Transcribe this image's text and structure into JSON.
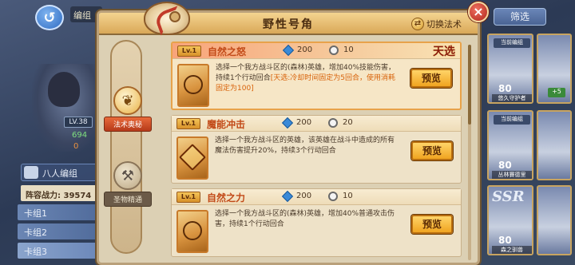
{
  "background": {
    "topbar_text": "编组",
    "hero_level": "LV.38",
    "hero_stat_1": "694",
    "hero_stat_2": "0",
    "crew_label": "八人编组",
    "power_label": "阵容战力: 39574",
    "decks": [
      "卡组1",
      "卡组2",
      "卡组3"
    ],
    "filter_label": "筛选",
    "cards": [
      {
        "grade": "当前编组",
        "level": "80",
        "name": "悠久守护者"
      },
      {
        "grade": "当前编组",
        "level": "80",
        "name": "丛林賽德里"
      },
      {
        "rarity": "SSR",
        "level": "80",
        "name": "森之驯兽"
      }
    ],
    "plus_label": "+5"
  },
  "dialog": {
    "title": "野性号角",
    "switch_label": "切换法术",
    "close_label": "×"
  },
  "side_tabs": [
    {
      "label": "法术奥秘",
      "active": true
    },
    {
      "label": "圣物精通",
      "active": false
    }
  ],
  "skills": [
    {
      "level": "Lv.1",
      "name": "自然之怒",
      "cost": "200",
      "cooldown": "10",
      "tag": "天选",
      "description_main": "选择一个我方战斗区的(森林)英雄，增加40%技能伤害，持续1个行动回合",
      "description_highlight": "[天选:冷却时间固定为5回合，使用消耗固定为100]",
      "preview_label": "预览",
      "selected": true
    },
    {
      "level": "Lv.1",
      "name": "魔能冲击",
      "cost": "200",
      "cooldown": "20",
      "tag": "",
      "description_main": "选择一个我方战斗区的英雄，该英雄在战斗中造成的所有魔法伤害提升20%，持续3个行动回合",
      "description_highlight": "",
      "preview_label": "预览",
      "selected": false
    },
    {
      "level": "Lv.1",
      "name": "自然之力",
      "cost": "200",
      "cooldown": "10",
      "tag": "",
      "description_main": "选择一个我方战斗区的(森林)英雄，增加40%普通攻击伤害，持续1个行动回合",
      "description_highlight": "",
      "preview_label": "预览",
      "selected": false
    }
  ],
  "colors": {
    "accent": "#f0a420",
    "skill_name": "#c24a18",
    "highlight_text": "#d8620a",
    "tag": "#8a1a0a"
  }
}
